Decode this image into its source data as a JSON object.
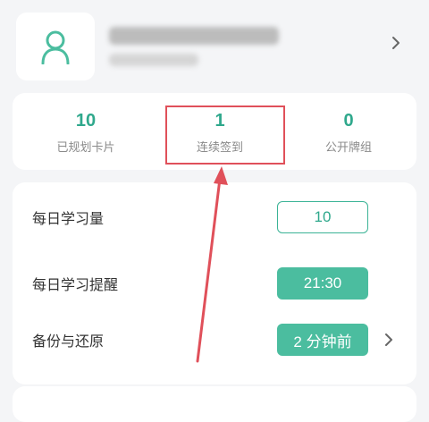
{
  "profile": {
    "avatar_icon": "user-outline-icon",
    "chevron_icon": "chevron-right-icon"
  },
  "stats": [
    {
      "value": "10",
      "label": "已规划卡片"
    },
    {
      "value": "1",
      "label": "连续签到"
    },
    {
      "value": "0",
      "label": "公开牌组"
    }
  ],
  "settings": {
    "daily_amount": {
      "label": "每日学习量",
      "value": "10"
    },
    "daily_reminder": {
      "label": "每日学习提醒",
      "value": "21:30"
    },
    "backup": {
      "label": "备份与还原",
      "value": "2 分钟前"
    }
  },
  "colors": {
    "accent": "#4bbd9f",
    "accent_text": "#2fa88c",
    "highlight": "#e0505a"
  }
}
